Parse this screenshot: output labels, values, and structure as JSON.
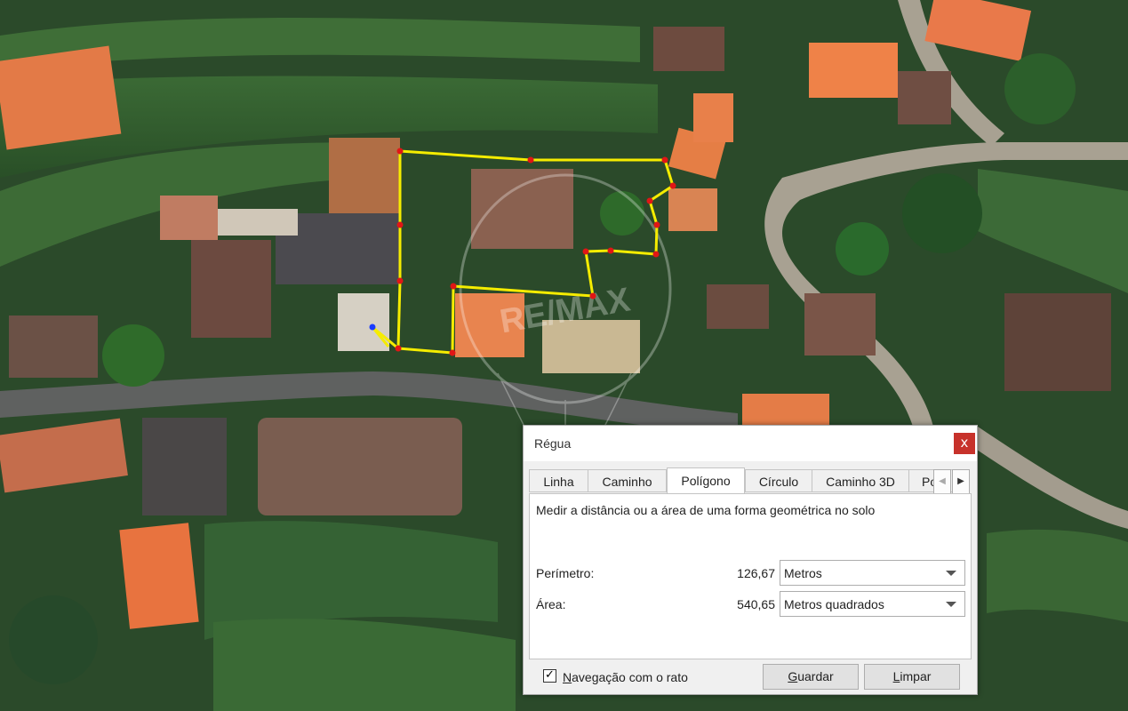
{
  "dialog": {
    "title": "Régua",
    "close_glyph": "x",
    "tabs": [
      {
        "label": "Linha",
        "active": false
      },
      {
        "label": "Caminho",
        "active": false
      },
      {
        "label": "Polígono",
        "active": true
      },
      {
        "label": "Círculo",
        "active": false
      },
      {
        "label": "Caminho 3D",
        "active": false
      },
      {
        "label": "Po",
        "active": false
      }
    ],
    "tab_scroll": {
      "left_icon": "triangle-left-icon",
      "right_icon": "triangle-right-icon",
      "left_glyph": "◀",
      "right_glyph": "▶"
    },
    "description": "Medir a distância ou a área de uma forma geométrica no solo",
    "perimeter": {
      "label": "Perímetro:",
      "value": "126,67",
      "unit": "Metros"
    },
    "area": {
      "label": "Área:",
      "value": "540,65",
      "unit": "Metros quadrados"
    },
    "mouse_nav": {
      "label_first": "N",
      "label_rest": "avegação com o rato",
      "checked": true,
      "check_glyph": "✓"
    },
    "buttons": {
      "save": {
        "first": "G",
        "rest": "uardar"
      },
      "clear": {
        "first": "L",
        "rest": "impar"
      }
    }
  },
  "colors": {
    "polygon_line": "#f5ec00",
    "polygon_vertex": "#e01616",
    "cursor_point": "#1a3cff",
    "close_button": "#c7322b",
    "roof_tile": "#e37a47",
    "vegetation": "#2f5a2c"
  },
  "watermark_text": "RE/MAX"
}
